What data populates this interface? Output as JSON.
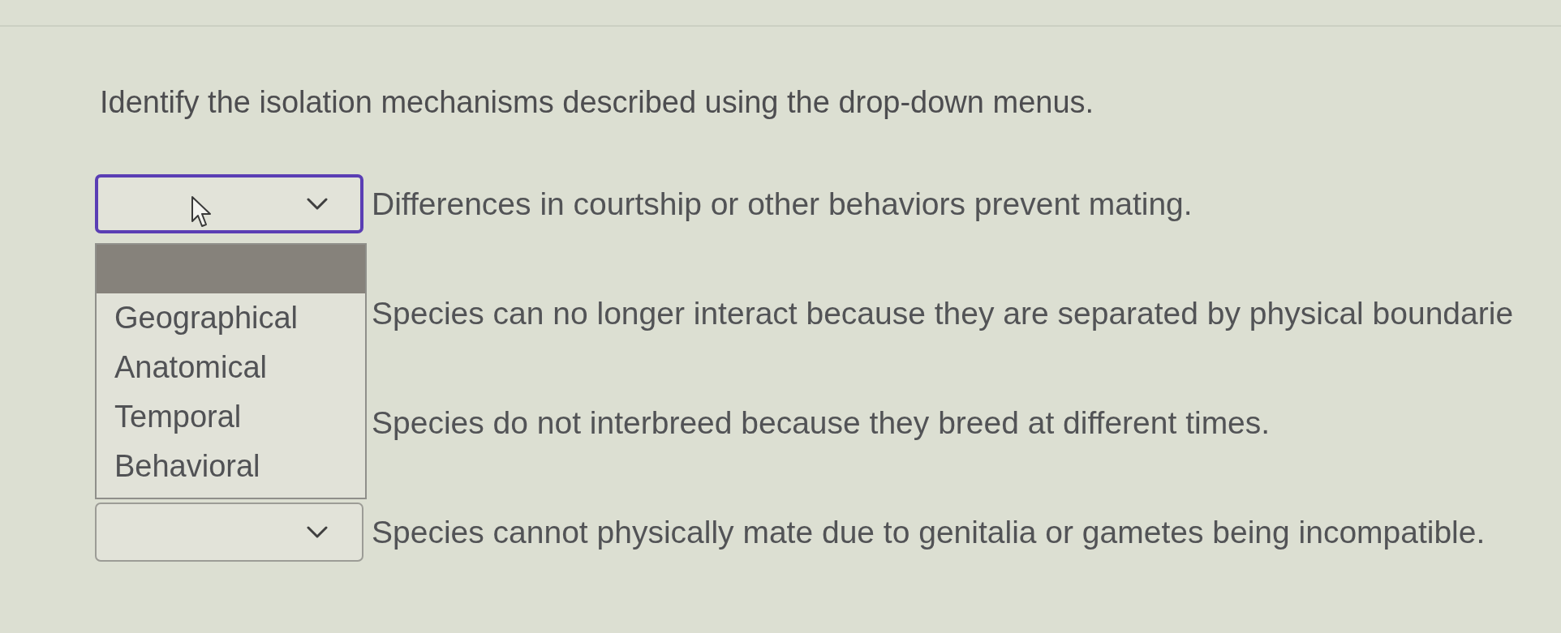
{
  "instruction": "Identify the isolation mechanisms described using the drop-down menus.",
  "items": [
    {
      "dropdown": {
        "open": true,
        "blank_highlighted": true,
        "options": [
          {
            "label": "Geographical",
            "selected": false
          },
          {
            "label": "Anatomical",
            "selected": false
          },
          {
            "label": "Temporal",
            "selected": false
          },
          {
            "label": "Behavioral",
            "selected": false
          }
        ]
      },
      "description": "Differences in courtship or other behaviors prevent mating."
    },
    {
      "description": "Species can no longer interact because they are separated by physical boundarie"
    },
    {
      "description": "Species do not interbreed because they breed at different times."
    },
    {
      "dropdown": {
        "open": false
      },
      "description": "Species cannot physically mate due to genitalia or gametes being incompatible."
    }
  ]
}
